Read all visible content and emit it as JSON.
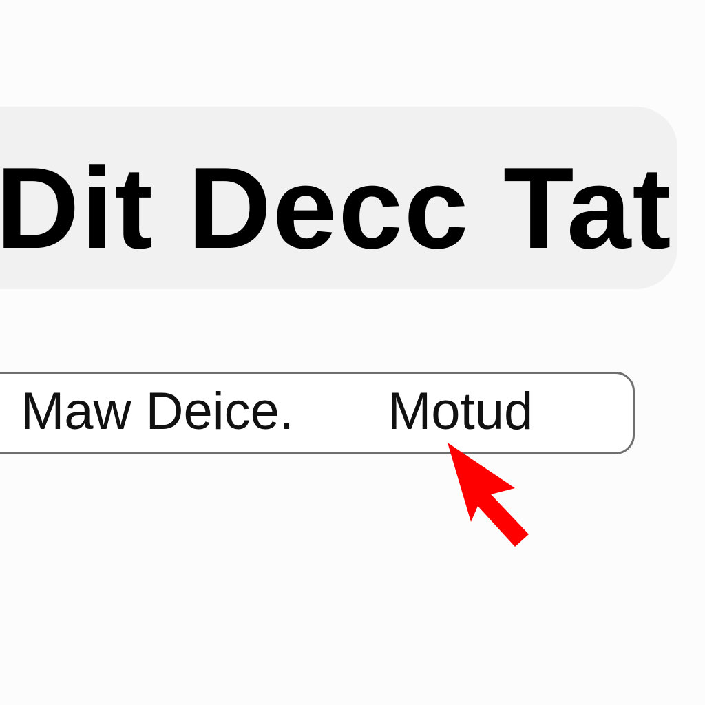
{
  "header": {
    "title": "Dit Decc Tat"
  },
  "option_bar": {
    "options": [
      {
        "label": "Maw Deice."
      },
      {
        "label": "Motud"
      }
    ]
  },
  "cursor": {
    "icon": "arrow-pointer-icon",
    "color": "#ff0000"
  }
}
